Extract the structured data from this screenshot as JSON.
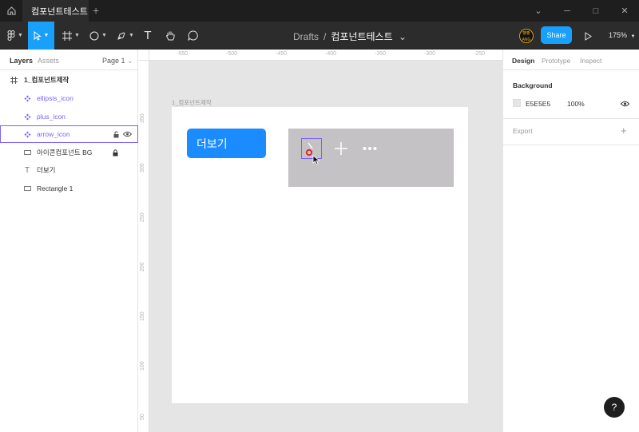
{
  "titlebar": {
    "tab_label": "컴포넌트테스트",
    "new_tab": "+",
    "minimize": "─",
    "maximize": "□",
    "close": "✕",
    "chevron": "⌄"
  },
  "toolbar": {
    "breadcrumb_drafts": "Drafts",
    "breadcrumb_sep": "/",
    "file_name": "컴포넌트테스트",
    "file_caret": "⌄",
    "avatar_text": "빵빵 ANG",
    "share_label": "Share",
    "zoom_label": "175%",
    "tool_text_glyph": "T"
  },
  "layers_panel": {
    "tab_layers": "Layers",
    "tab_assets": "Assets",
    "page_label": "Page 1",
    "page_caret": "⌄",
    "items": [
      {
        "name": "1_컴포넌트제작",
        "icon": "frame-hash-icon"
      },
      {
        "name": "ellipsis_icon",
        "icon": "component-icon"
      },
      {
        "name": "plus_icon",
        "icon": "component-icon"
      },
      {
        "name": "arrow_icon",
        "icon": "component-icon"
      },
      {
        "name": "아이콘컴포넌트 BG",
        "icon": "rectangle-icon"
      },
      {
        "name": "더보기",
        "icon": "text-icon"
      },
      {
        "name": "Rectangle 1",
        "icon": "rectangle-icon"
      }
    ],
    "text_icon_glyph": "T"
  },
  "canvas": {
    "ruler_top": [
      "-550",
      "-500",
      "-450",
      "-400",
      "-350",
      "-300",
      "-250"
    ],
    "ruler_left": [
      "350",
      "300",
      "250",
      "200",
      "150",
      "100",
      "50"
    ],
    "frame_label": "1_컴포넌트제작",
    "more_button_label": "더보기"
  },
  "design_panel": {
    "tab_design": "Design",
    "tab_prototype": "Prototype",
    "tab_inspect": "Inspect",
    "background_label": "Background",
    "background_hex": "E5E5E5",
    "background_opacity": "100%",
    "export_label": "Export",
    "export_add": "+"
  },
  "help_label": "?",
  "colors": {
    "accent": "#18a0fb",
    "component": "#7b61ff",
    "canvas_bg": "#e5e5e5",
    "button_blue": "#1a8cff"
  }
}
